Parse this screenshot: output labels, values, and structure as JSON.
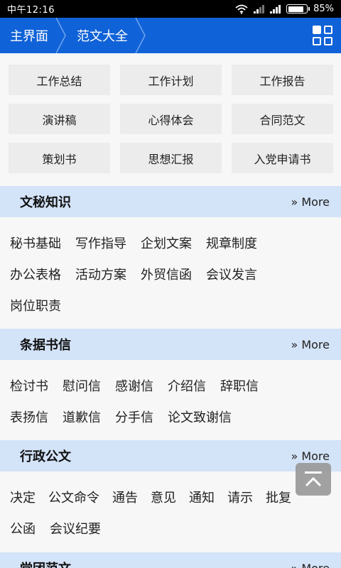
{
  "status": {
    "time": "中午12:16",
    "battery": "85%",
    "battery_level": 0.85
  },
  "nav": {
    "crumbs": [
      "主界面",
      "范文大全"
    ]
  },
  "categories": [
    "工作总结",
    "工作计划",
    "工作报告",
    "演讲稿",
    "心得体会",
    "合同范文",
    "策划书",
    "思想汇报",
    "入党申请书"
  ],
  "sections": [
    {
      "title": "文秘知识",
      "more": "» More",
      "rows": [
        [
          "秘书基础",
          "写作指导",
          "企划文案",
          "规章制度"
        ],
        [
          "办公表格",
          "活动方案",
          "外贸信函",
          "会议发言"
        ],
        [
          "岗位职责"
        ]
      ]
    },
    {
      "title": "条据书信",
      "more": "» More",
      "rows": [
        [
          "检讨书",
          "慰问信",
          "感谢信",
          "介绍信",
          "辞职信"
        ],
        [
          "表扬信",
          "道歉信",
          "分手信",
          "论文致谢信"
        ]
      ]
    },
    {
      "title": "行政公文",
      "more": "» More",
      "rows": [
        [
          "决定",
          "公文命令",
          "通告",
          "意见",
          "通知",
          "请示",
          "批复"
        ],
        [
          "公函",
          "会议纪要"
        ]
      ]
    },
    {
      "title": "党团范文",
      "more": "» More",
      "rows": []
    }
  ],
  "colors": {
    "navbar": "#1062d8",
    "section_header": "#d3e3f8",
    "category_tile": "#ececec"
  },
  "icons": {
    "nav_menu": "grid-icon",
    "back_to_top": "back-to-top-icon"
  }
}
